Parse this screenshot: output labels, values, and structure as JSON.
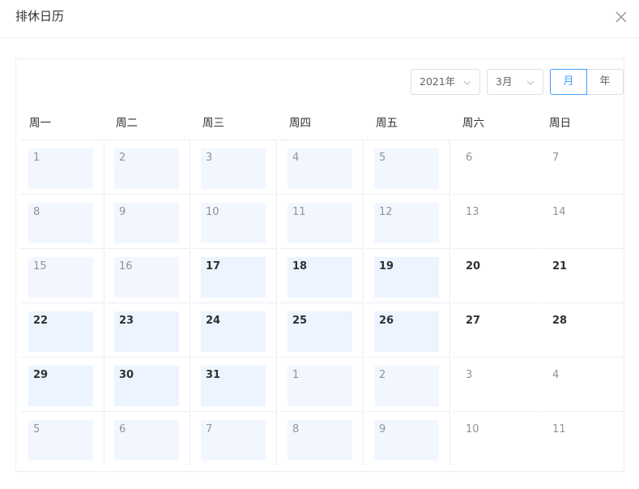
{
  "dialog": {
    "title": "排休日历",
    "close_icon": "close-icon"
  },
  "toolbar": {
    "year_value": "2021年",
    "month_value": "3月",
    "view_month_label": "月",
    "view_year_label": "年",
    "active_view": "月"
  },
  "colors": {
    "accent": "#409eff",
    "work_day_bg": "#ecf5ff",
    "border": "#ebeef5"
  },
  "weekdays": [
    "周一",
    "周二",
    "周三",
    "周四",
    "周五",
    "周六",
    "周日"
  ],
  "weeks": [
    [
      {
        "day": "1",
        "month": "current",
        "workday": true,
        "past": true
      },
      {
        "day": "2",
        "month": "current",
        "workday": true,
        "past": true
      },
      {
        "day": "3",
        "month": "current",
        "workday": true,
        "past": true
      },
      {
        "day": "4",
        "month": "current",
        "workday": true,
        "past": true
      },
      {
        "day": "5",
        "month": "current",
        "workday": true,
        "past": true
      },
      {
        "day": "6",
        "month": "current",
        "workday": false,
        "past": true
      },
      {
        "day": "7",
        "month": "current",
        "workday": false,
        "past": true
      }
    ],
    [
      {
        "day": "8",
        "month": "current",
        "workday": true,
        "past": true
      },
      {
        "day": "9",
        "month": "current",
        "workday": true,
        "past": true
      },
      {
        "day": "10",
        "month": "current",
        "workday": true,
        "past": true
      },
      {
        "day": "11",
        "month": "current",
        "workday": true,
        "past": true
      },
      {
        "day": "12",
        "month": "current",
        "workday": true,
        "past": true
      },
      {
        "day": "13",
        "month": "current",
        "workday": false,
        "past": true
      },
      {
        "day": "14",
        "month": "current",
        "workday": false,
        "past": true
      }
    ],
    [
      {
        "day": "15",
        "month": "current",
        "workday": true,
        "past": true
      },
      {
        "day": "16",
        "month": "current",
        "workday": true,
        "past": true
      },
      {
        "day": "17",
        "month": "current",
        "workday": true,
        "past": false
      },
      {
        "day": "18",
        "month": "current",
        "workday": true,
        "past": false
      },
      {
        "day": "19",
        "month": "current",
        "workday": true,
        "past": false
      },
      {
        "day": "20",
        "month": "current",
        "workday": false,
        "past": false
      },
      {
        "day": "21",
        "month": "current",
        "workday": false,
        "past": false
      }
    ],
    [
      {
        "day": "22",
        "month": "current",
        "workday": true,
        "past": false
      },
      {
        "day": "23",
        "month": "current",
        "workday": true,
        "past": false
      },
      {
        "day": "24",
        "month": "current",
        "workday": true,
        "past": false
      },
      {
        "day": "25",
        "month": "current",
        "workday": true,
        "past": false
      },
      {
        "day": "26",
        "month": "current",
        "workday": true,
        "past": false
      },
      {
        "day": "27",
        "month": "current",
        "workday": false,
        "past": false
      },
      {
        "day": "28",
        "month": "current",
        "workday": false,
        "past": false
      }
    ],
    [
      {
        "day": "29",
        "month": "current",
        "workday": true,
        "past": false
      },
      {
        "day": "30",
        "month": "current",
        "workday": true,
        "past": false
      },
      {
        "day": "31",
        "month": "current",
        "workday": true,
        "past": false
      },
      {
        "day": "1",
        "month": "next",
        "workday": true,
        "past": false
      },
      {
        "day": "2",
        "month": "next",
        "workday": true,
        "past": false
      },
      {
        "day": "3",
        "month": "next",
        "workday": false,
        "past": false
      },
      {
        "day": "4",
        "month": "next",
        "workday": false,
        "past": false
      }
    ],
    [
      {
        "day": "5",
        "month": "next",
        "workday": true,
        "past": false
      },
      {
        "day": "6",
        "month": "next",
        "workday": true,
        "past": false
      },
      {
        "day": "7",
        "month": "next",
        "workday": true,
        "past": false
      },
      {
        "day": "8",
        "month": "next",
        "workday": true,
        "past": false
      },
      {
        "day": "9",
        "month": "next",
        "workday": true,
        "past": false
      },
      {
        "day": "10",
        "month": "next",
        "workday": false,
        "past": false
      },
      {
        "day": "11",
        "month": "next",
        "workday": false,
        "past": false
      }
    ]
  ]
}
